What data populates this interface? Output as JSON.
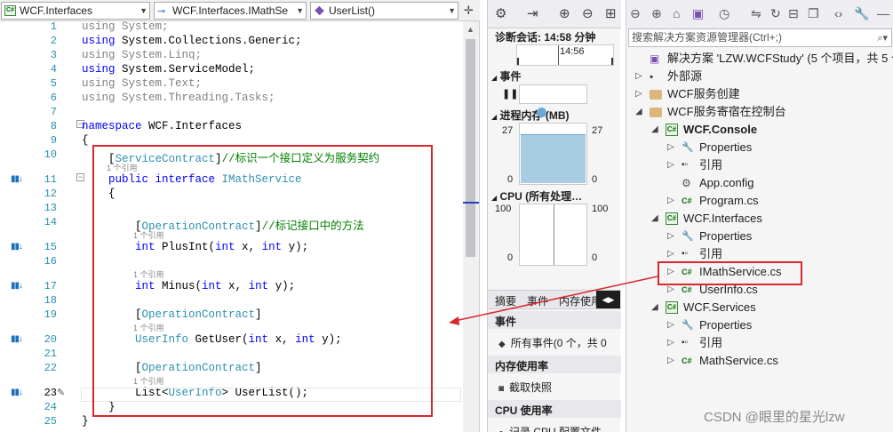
{
  "navbar": {
    "project": "WCF.Interfaces",
    "type": "WCF.Interfaces.IMathSe",
    "member": "UserList()"
  },
  "lines": [
    {
      "num": "1",
      "parts": [
        {
          "t": "using System;",
          "c": "gr"
        }
      ]
    },
    {
      "num": "2",
      "parts": [
        {
          "t": "using ",
          "c": "kw"
        },
        {
          "t": "System.Collections.Generic;",
          "c": "pl"
        }
      ]
    },
    {
      "num": "3",
      "parts": [
        {
          "t": "using System.Linq;",
          "c": "gr"
        }
      ]
    },
    {
      "num": "4",
      "parts": [
        {
          "t": "using ",
          "c": "kw"
        },
        {
          "t": "System.ServiceModel;",
          "c": "pl"
        }
      ]
    },
    {
      "num": "5",
      "parts": [
        {
          "t": "using System.Text;",
          "c": "gr"
        }
      ]
    },
    {
      "num": "6",
      "parts": [
        {
          "t": "using System.Threading.Tasks;",
          "c": "gr"
        }
      ]
    },
    {
      "num": "7",
      "parts": []
    },
    {
      "num": "8",
      "parts": [
        {
          "t": "namespace ",
          "c": "kw"
        },
        {
          "t": "WCF.Interfaces",
          "c": "pl"
        }
      ]
    },
    {
      "num": "9",
      "parts": [
        {
          "t": "{",
          "c": "pl"
        }
      ]
    },
    {
      "num": "10",
      "parts": [
        {
          "t": "    [",
          "c": "pl"
        },
        {
          "t": "ServiceContract",
          "c": "ty"
        },
        {
          "t": "]",
          "c": "pl"
        },
        {
          "t": "//标识一个接口定义为服务契约",
          "c": "cm"
        }
      ],
      "lens": "1 个引用"
    },
    {
      "num": "11",
      "parts": [
        {
          "t": "    public interface ",
          "c": "kw"
        },
        {
          "t": "IMathService",
          "c": "ty"
        }
      ]
    },
    {
      "num": "12",
      "parts": [
        {
          "t": "    {",
          "c": "pl"
        }
      ]
    },
    {
      "num": "13",
      "parts": []
    },
    {
      "num": "14",
      "parts": [
        {
          "t": "        [",
          "c": "pl"
        },
        {
          "t": "OperationContract",
          "c": "ty"
        },
        {
          "t": "]",
          "c": "pl"
        },
        {
          "t": "//标记接口中的方法",
          "c": "cm"
        }
      ],
      "lens": "1 个引用"
    },
    {
      "num": "15",
      "parts": [
        {
          "t": "        int ",
          "c": "kw"
        },
        {
          "t": "PlusInt(",
          "c": "pl"
        },
        {
          "t": "int ",
          "c": "kw"
        },
        {
          "t": "x, ",
          "c": "pl"
        },
        {
          "t": "int ",
          "c": "kw"
        },
        {
          "t": "y);",
          "c": "pl"
        }
      ]
    },
    {
      "num": "16",
      "parts": [],
      "lens": "1 个引用"
    },
    {
      "num": "17",
      "parts": [
        {
          "t": "        int ",
          "c": "kw"
        },
        {
          "t": "Minus(",
          "c": "pl"
        },
        {
          "t": "int ",
          "c": "kw"
        },
        {
          "t": "x, ",
          "c": "pl"
        },
        {
          "t": "int ",
          "c": "kw"
        },
        {
          "t": "y);",
          "c": "pl"
        }
      ]
    },
    {
      "num": "18",
      "parts": []
    },
    {
      "num": "19",
      "parts": [
        {
          "t": "        [",
          "c": "pl"
        },
        {
          "t": "OperationContract",
          "c": "ty"
        },
        {
          "t": "]",
          "c": "pl"
        }
      ],
      "lens": "1 个引用"
    },
    {
      "num": "20",
      "parts": [
        {
          "t": "        ",
          "c": "pl"
        },
        {
          "t": "UserInfo",
          "c": "ty"
        },
        {
          "t": " GetUser(",
          "c": "pl"
        },
        {
          "t": "int ",
          "c": "kw"
        },
        {
          "t": "x, ",
          "c": "pl"
        },
        {
          "t": "int ",
          "c": "kw"
        },
        {
          "t": "y);",
          "c": "pl"
        }
      ]
    },
    {
      "num": "21",
      "parts": []
    },
    {
      "num": "22",
      "parts": [
        {
          "t": "        [",
          "c": "pl"
        },
        {
          "t": "OperationContract",
          "c": "ty"
        },
        {
          "t": "]",
          "c": "pl"
        }
      ],
      "lens": "1 个引用"
    },
    {
      "num": "23",
      "parts": [
        {
          "t": "        List<",
          "c": "pl"
        },
        {
          "t": "UserInfo",
          "c": "ty"
        },
        {
          "t": "> UserList();",
          "c": "pl"
        }
      ]
    },
    {
      "num": "24",
      "parts": [
        {
          "t": "    }",
          "c": "pl"
        }
      ]
    },
    {
      "num": "25",
      "parts": [
        {
          "t": "}",
          "c": "pl"
        }
      ]
    }
  ],
  "diag": {
    "session": "诊断会话: 14:58 分钟",
    "time": "14:56",
    "events": "事件",
    "memory": "进程内存 (MB)",
    "mem_max": "27",
    "mem_min": "0",
    "memory_level": 0.95,
    "cpu": "CPU (所有处理…",
    "cpu_max": "100",
    "cpu_min": "0",
    "tabs": [
      "摘要",
      "事件",
      "内存使用"
    ],
    "list": [
      {
        "kind": "h",
        "text": "事件"
      },
      {
        "kind": "i",
        "icon": "◆",
        "text": "所有事件(0 个，共 0"
      },
      {
        "kind": "h",
        "text": "内存使用率"
      },
      {
        "kind": "i",
        "icon": "◙",
        "text": "截取快照"
      },
      {
        "kind": "h",
        "text": "CPU 使用率"
      },
      {
        "kind": "i",
        "icon": "●",
        "text": "记录 CPU 配置文件"
      }
    ]
  },
  "sol": {
    "search": "搜索解决方案资源管理器(Ctrl+;)",
    "items": [
      {
        "text": "解决方案 'LZW.WCFStudy' (5 个项目，共 5 个)",
        "icon": "sln",
        "arrow": "",
        "bold": false
      },
      {
        "text": "外部源",
        "icon": "ext",
        "arrow": "▷",
        "bold": false
      },
      {
        "text": "WCF服务创建",
        "icon": "folder",
        "arrow": "▷",
        "bold": false
      },
      {
        "text": "WCF服务寄宿在控制台",
        "icon": "folder",
        "arrow": "◢",
        "bold": false
      },
      {
        "text": "WCF.Console",
        "icon": "csproj",
        "arrow": "◢",
        "bold": true
      },
      {
        "text": "Properties",
        "icon": "wrench",
        "arrow": "▷",
        "bold": false
      },
      {
        "text": "引用",
        "icon": "ref",
        "arrow": "▷",
        "bold": false
      },
      {
        "text": "App.config",
        "icon": "config",
        "arrow": "",
        "bold": false
      },
      {
        "text": "Program.cs",
        "icon": "cs",
        "arrow": "▷",
        "bold": false
      },
      {
        "text": "WCF.Interfaces",
        "icon": "csproj",
        "arrow": "◢",
        "bold": false
      },
      {
        "text": "Properties",
        "icon": "wrench",
        "arrow": "▷",
        "bold": false
      },
      {
        "text": "引用",
        "icon": "ref",
        "arrow": "▷",
        "bold": false
      },
      {
        "text": "IMathService.cs",
        "icon": "cs",
        "arrow": "▷",
        "bold": false
      },
      {
        "text": "UserInfo.cs",
        "icon": "cs",
        "arrow": "▷",
        "bold": false
      },
      {
        "text": "WCF.Services",
        "icon": "csproj",
        "arrow": "◢",
        "bold": false
      },
      {
        "text": "Properties",
        "icon": "wrench",
        "arrow": "▷",
        "bold": false
      },
      {
        "text": "引用",
        "icon": "ref",
        "arrow": "▷",
        "bold": false
      },
      {
        "text": "MathService.cs",
        "icon": "cs",
        "arrow": "▷",
        "bold": false
      }
    ]
  },
  "watermark": "CSDN @眼里的星光lzw"
}
